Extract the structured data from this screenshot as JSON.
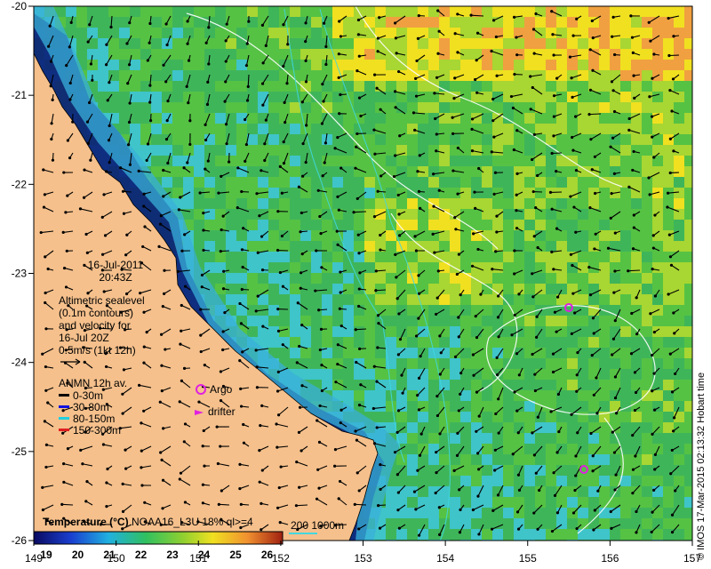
{
  "map": {
    "lon_ticks": [
      "149",
      "150",
      "151",
      "152",
      "153",
      "154",
      "155",
      "156",
      "157"
    ],
    "lat_ticks": [
      "-20",
      "-21",
      "-22",
      "-23",
      "-24",
      "-25",
      "-26"
    ],
    "land_color": "#f5c08c",
    "ocean_colors": [
      "#0a1e78",
      "#2a6fd6",
      "#3fc4c9",
      "#3fb55a",
      "#55c244",
      "#a8d632",
      "#f0e020",
      "#f0a040"
    ]
  },
  "info": {
    "date": "16-Jul-2011",
    "time": "20:43Z",
    "altimetry_lines": [
      "Altimetric sealevel",
      "(0.1m contours)",
      "and velocity for",
      "16-Jul 20Z"
    ],
    "velocity_scale": "0.5m/s (1kt 12h)",
    "anmn_title": "ANMN 12h av.",
    "anmn_items": [
      {
        "label": "0-30m",
        "color": "#000000"
      },
      {
        "label": "30-80m",
        "color": "#1010e0"
      },
      {
        "label": "80-150m",
        "color": "#20d0e0"
      },
      {
        "label": "150-300m",
        "color": "#e02020"
      }
    ]
  },
  "markers": {
    "argo_label": "Argo",
    "drifter_label": "drifter",
    "argo_color": "#e020e0"
  },
  "colorbar": {
    "title": "Temperature (°C)",
    "subtitle": "NOAA16_L3U 18% ql>=4",
    "ticks": [
      "19",
      "20",
      "21",
      "22",
      "23",
      "24",
      "25",
      "26"
    ],
    "contour_legend": "200  1000m"
  },
  "credit": "© IMOS 17-Mar-2015 02:13:32 Hobart time"
}
